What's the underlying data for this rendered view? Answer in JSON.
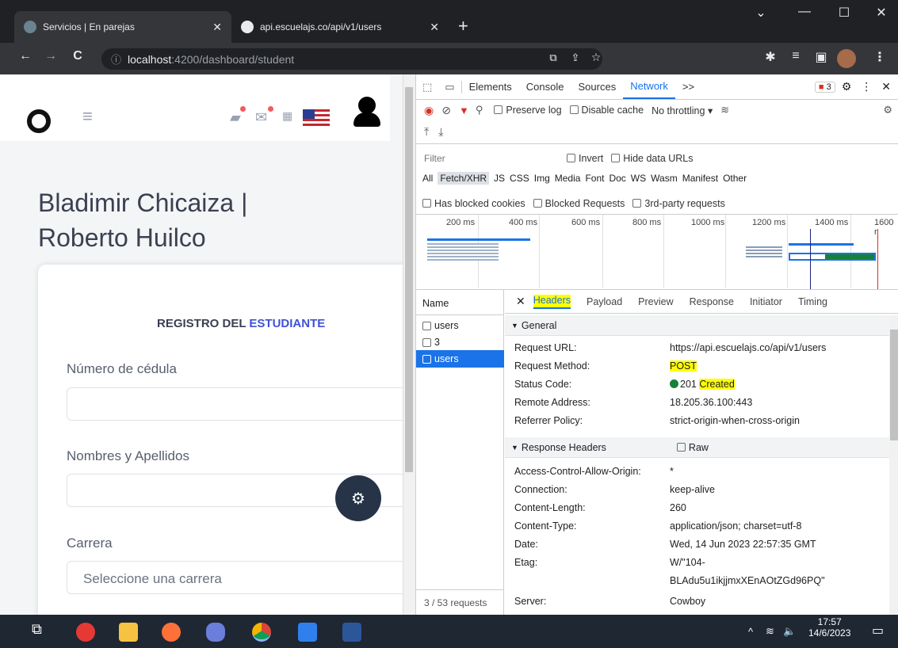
{
  "browser": {
    "tabs": [
      {
        "title": "Servicios | En parejas"
      },
      {
        "title": "api.escuelajs.co/api/v1/users"
      }
    ],
    "new_tab": "+",
    "url_host": "localhost",
    "url_rest": ":4200/dashboard/student"
  },
  "app": {
    "title_line1": "Bladimir Chicaiza |",
    "title_line2": "Roberto Huilco",
    "card_title_a": "REGISTRO DEL ",
    "card_title_b": "ESTUDIANTE",
    "fields": [
      {
        "label": "Número de cédula"
      },
      {
        "label": "Nombres y Apellidos"
      },
      {
        "label": "Carrera",
        "placeholder": "Seleccione una carrera"
      }
    ]
  },
  "devtools": {
    "tabs": [
      "Elements",
      "Console",
      "Sources",
      "Network",
      ">>"
    ],
    "active_tab": "Network",
    "issues_badge": "3",
    "preserve_log": "Preserve log",
    "disable_cache": "Disable cache",
    "throttling": "No throttling",
    "filter_placeholder": "Filter",
    "invert": "Invert",
    "hide_data_urls": "Hide data URLs",
    "type_filters": [
      "All",
      "Fetch/XHR",
      "JS",
      "CSS",
      "Img",
      "Media",
      "Font",
      "Doc",
      "WS",
      "Wasm",
      "Manifest",
      "Other"
    ],
    "has_blocked_cookies": "Has blocked cookies",
    "blocked_requests": "Blocked Requests",
    "third_party": "3rd-party requests",
    "timeline_ticks": [
      "200 ms",
      "400 ms",
      "600 ms",
      "800 ms",
      "1000 ms",
      "1200 ms",
      "1400 ms",
      "1600 r"
    ],
    "name_header": "Name",
    "requests": [
      "users",
      "3",
      "users"
    ],
    "requests_count": "3 / 53 requests",
    "detail_tabs": [
      "Headers",
      "Payload",
      "Preview",
      "Response",
      "Initiator",
      "Timing"
    ],
    "general_title": "General",
    "general": [
      {
        "key": "Request URL:",
        "value": "https://api.escuelajs.co/api/v1/users"
      },
      {
        "key": "Request Method:",
        "value": "POST"
      },
      {
        "key": "Status Code:",
        "value": "201",
        "extra": "Created"
      },
      {
        "key": "Remote Address:",
        "value": "18.205.36.100:443"
      },
      {
        "key": "Referrer Policy:",
        "value": "strict-origin-when-cross-origin"
      }
    ],
    "response_headers_title": "Response Headers",
    "raw_label": "Raw",
    "response_headers": [
      {
        "key": "Access-Control-Allow-Origin:",
        "value": "*"
      },
      {
        "key": "Connection:",
        "value": "keep-alive"
      },
      {
        "key": "Content-Length:",
        "value": "260"
      },
      {
        "key": "Content-Type:",
        "value": "application/json; charset=utf-8"
      },
      {
        "key": "Date:",
        "value": "Wed, 14 Jun 2023 22:57:35 GMT"
      },
      {
        "key": "Etag:",
        "value": "W/\"104-"
      },
      {
        "key": "",
        "value": "BLAdu5u1ikjjmxXEnAOtZGd96PQ\""
      },
      {
        "key": "Server:",
        "value": "Cowboy"
      }
    ]
  },
  "taskbar": {
    "time": "17:57",
    "date": "14/6/2023"
  }
}
